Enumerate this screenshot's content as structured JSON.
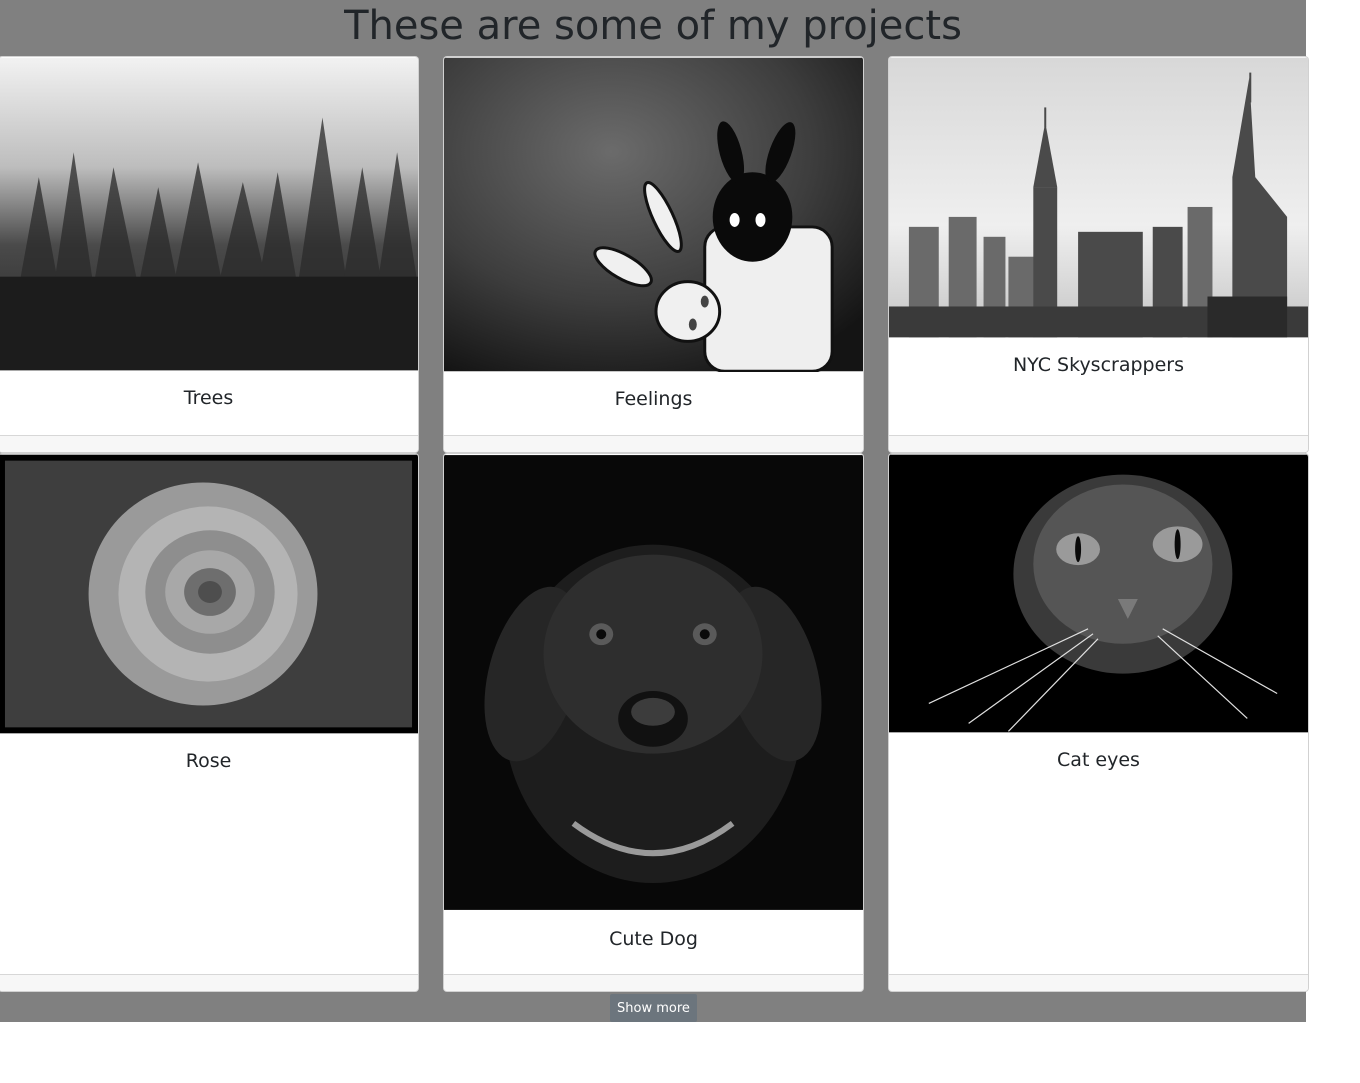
{
  "page": {
    "heading": "These are some of my projects",
    "show_more_label": "Show more",
    "background_color": "#808080"
  },
  "cards": [
    {
      "title": "Trees",
      "image": "misty-forest-photo"
    },
    {
      "title": "Feelings",
      "image": "bunny-costume-illustration"
    },
    {
      "title": "NYC Skyscrappers",
      "image": "nyc-skyline-photo"
    },
    {
      "title": "Rose",
      "image": "rose-photo"
    },
    {
      "title": "Cute Dog",
      "image": "labrador-puppy-photo"
    },
    {
      "title": "Cat eyes",
      "image": "cat-face-photo"
    }
  ]
}
